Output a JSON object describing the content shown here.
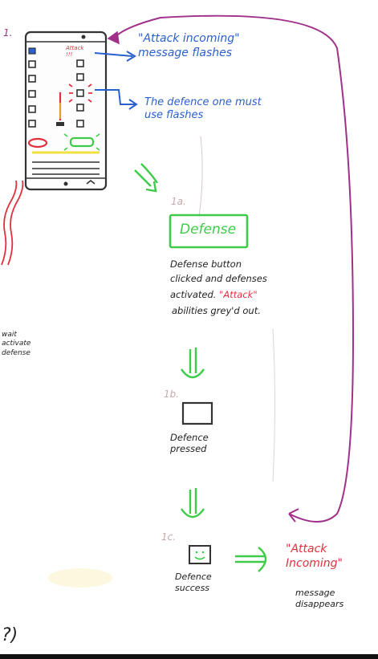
{
  "accent": {
    "blue": "#2a5fd0",
    "red": "#e0303e",
    "green": "#3ecb4a",
    "purple": "#a0308a",
    "gray": "#333333"
  },
  "steps": {
    "step1": {
      "number": "1."
    },
    "step1a": {
      "number": "1a.",
      "button": "Defense"
    },
    "step1b": {
      "number": "1b."
    },
    "step1c": {
      "number": "1c."
    }
  },
  "annotations": {
    "attack_incoming_flashes": "\"Attack incoming\"\nmessage flashes",
    "defence_flashes": "The defence one must\nuse flashes",
    "defense_clicked_line1": "Defense button",
    "defense_clicked_line2": "clicked and defenses",
    "defense_clicked_line3a": "activated. ",
    "defense_clicked_line3b": "\"Attack\"",
    "defense_clicked_line4": "abilities grey'd out.",
    "defence_pressed": "Defence\npressed",
    "defence_success": "Defence\nsuccess",
    "attack_incoming_red": "\"Attack\nIncoming\"",
    "message_disappears": "message\ndisappears",
    "left_cutoff": "wait\nactivate\ndefense",
    "phone_attack_label": "Attack\n!!!",
    "bottom_left": "?)"
  }
}
